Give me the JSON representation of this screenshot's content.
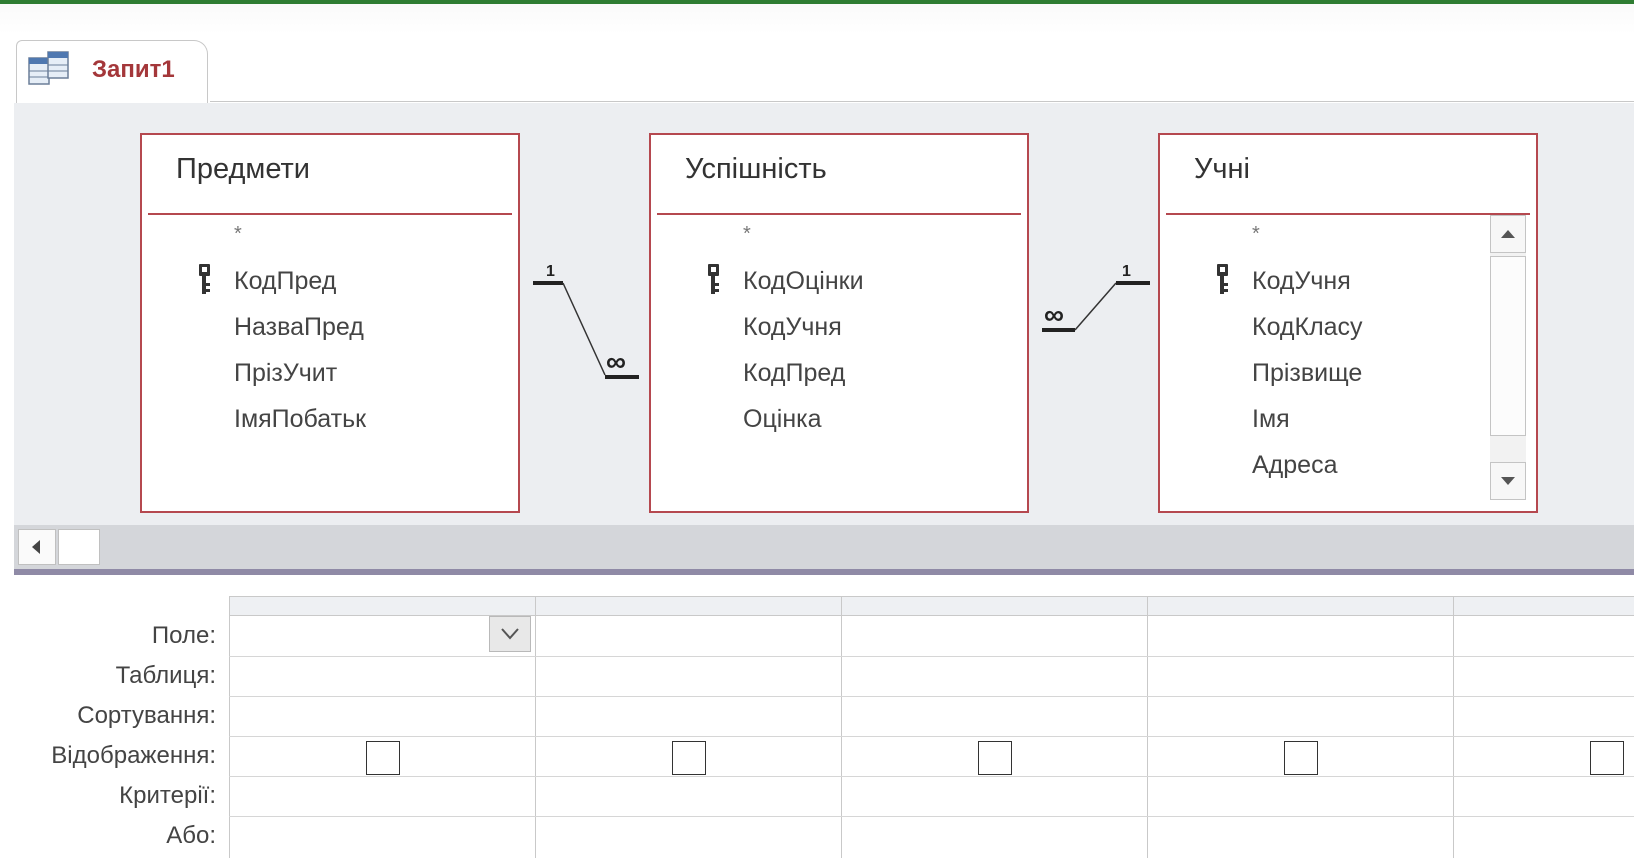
{
  "document_tab": {
    "title": "Запит1"
  },
  "tables": [
    {
      "name": "Предмети",
      "star": "*",
      "fields": [
        "КодПред",
        "НазваПред",
        "ПрізУчит",
        "ІмяПобатьк"
      ]
    },
    {
      "name": "Успішність",
      "star": "*",
      "fields": [
        "КодОцінки",
        "КодУчня",
        "КодПред",
        "Оцінка"
      ]
    },
    {
      "name": "Учні",
      "star": "*",
      "fields": [
        "КодУчня",
        "КодКласу",
        "Прізвище",
        "Імя",
        "Адреса"
      ]
    }
  ],
  "relationships": [
    {
      "one_label": "1",
      "many_label": "∞"
    },
    {
      "one_label": "1",
      "many_label": "∞"
    }
  ],
  "grid": {
    "row_labels": [
      "Поле:",
      "Таблиця:",
      "Сортування:",
      "Відображення:",
      "Критерії:",
      "Або:"
    ],
    "columns": [
      {
        "field": "",
        "show": false
      },
      {
        "field": "",
        "show": false
      },
      {
        "field": "",
        "show": false
      },
      {
        "field": "",
        "show": false
      },
      {
        "field": "",
        "show": false
      }
    ]
  },
  "colors": {
    "accent_green": "#2e7d32",
    "table_border": "#b5484f",
    "tab_title": "#a4373a",
    "splitter": "#8f8aa6"
  },
  "icons": [
    "query-design-icon",
    "primary-key-icon",
    "scroll-up-icon",
    "scroll-down-icon",
    "scroll-left-icon",
    "dropdown-chevron-icon"
  ]
}
